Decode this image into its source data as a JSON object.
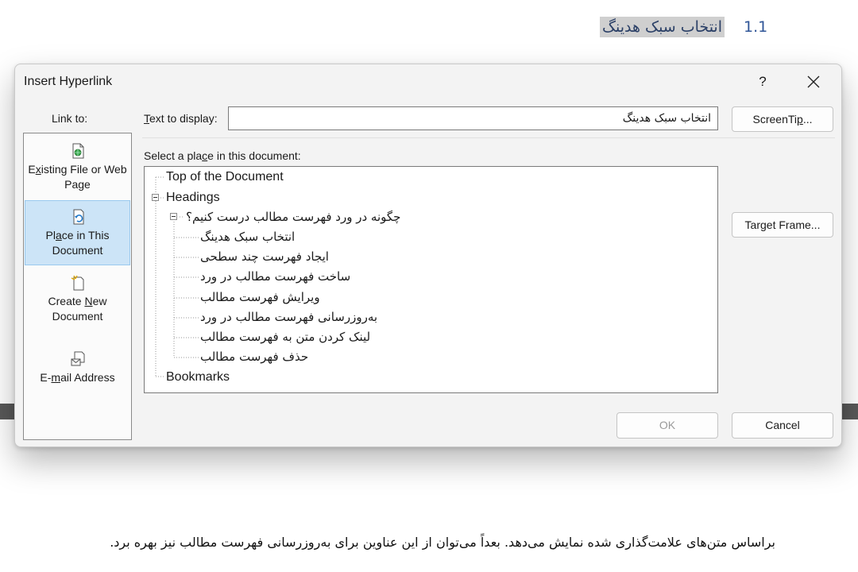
{
  "document": {
    "heading_number": "1.1",
    "heading_text": "انتخاب سبک هدینگ",
    "paragraph": "براساس متن‌های علامت‌گذاری شده نمایش می‌دهد. بعداً می‌توان از این عناوین برای به‌روزرسانی فهرست مطالب نیز بهره برد."
  },
  "dialog": {
    "title": "Insert Hyperlink",
    "help_label": "?",
    "link_to_label": "Link to:",
    "link_options": [
      {
        "label_pre": "E",
        "label_key": "x",
        "label_post": "isting File or Web Page",
        "icon": "existing-file-icon"
      },
      {
        "label_pre": "Pl",
        "label_key": "a",
        "label_post": "ce in This Document",
        "icon": "place-in-document-icon",
        "selected": true
      },
      {
        "label_pre": "Create ",
        "label_key": "N",
        "label_post": "ew Document",
        "icon": "new-document-icon"
      },
      {
        "label_pre": "E-",
        "label_key": "m",
        "label_post": "ail Address",
        "icon": "email-icon"
      }
    ],
    "text_to_display": {
      "label_key": "T",
      "label_rest": "ext to display:",
      "value": "انتخاب سبک هدینگ"
    },
    "screentip": {
      "pre": "ScreenTi",
      "key": "p",
      "post": "..."
    },
    "select_place": {
      "pre": "Select a pla",
      "key": "c",
      "post": "e in this document:"
    },
    "tree": {
      "top": "Top of the Document",
      "headings": "Headings",
      "parent": "چگونه در ورد فهرست مطالب درست کنیم؟",
      "children": [
        "انتخاب سبک هدینگ",
        "ایجاد فهرست چند سطحی",
        "ساخت فهرست مطالب در ورد",
        "ویرایش فهرست مطالب",
        "به‌روزرسانی فهرست مطالب در ورد",
        "لینک کردن متن به فهرست مطالب",
        "حذف فهرست مطالب"
      ],
      "bookmarks": "Bookmarks"
    },
    "target_frame": {
      "pre": "Tar",
      "key": "g",
      "post": "et Frame..."
    },
    "ok_label": "OK",
    "cancel_label": "Cancel"
  },
  "colors": {
    "selected_bg": "#cce4f7",
    "heading_highlight": "#cfcfcf",
    "heading_number": "#2f5597",
    "ok_disabled_text": "#9a9a9a"
  }
}
